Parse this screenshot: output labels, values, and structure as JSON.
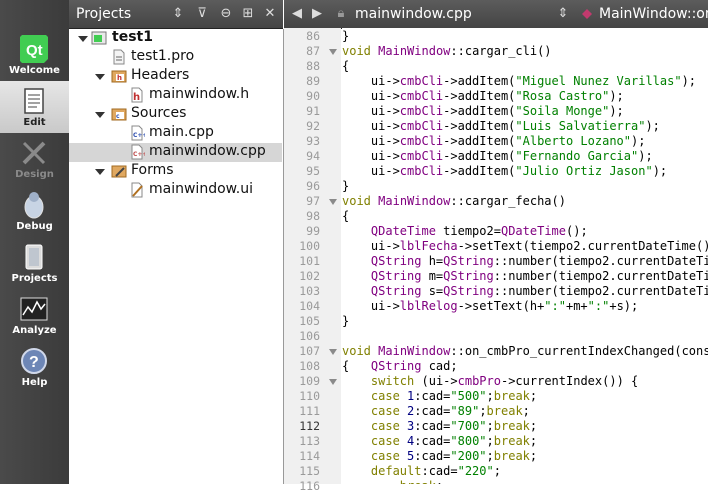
{
  "modes": [
    {
      "label": "Welcome",
      "icon": "qt-logo-icon",
      "state": "normal"
    },
    {
      "label": "Edit",
      "icon": "edit-document-icon",
      "state": "active"
    },
    {
      "label": "Design",
      "icon": "design-icon",
      "state": "disabled"
    },
    {
      "label": "Debug",
      "icon": "debug-bug-icon",
      "state": "normal"
    },
    {
      "label": "Projects",
      "icon": "projects-icon",
      "state": "normal"
    },
    {
      "label": "Analyze",
      "icon": "analyze-icon",
      "state": "normal"
    },
    {
      "label": "Help",
      "icon": "help-icon",
      "state": "normal"
    }
  ],
  "qt_logo_text": "Qt",
  "sidebar": {
    "title": "Projects",
    "tree": [
      {
        "label": "test1",
        "bold": true,
        "icon": "project-icon"
      },
      {
        "label": "test1.pro",
        "icon": "pro-file-icon"
      },
      {
        "label": "Headers",
        "icon": "folder-headers-icon"
      },
      {
        "label": "mainwindow.h",
        "icon": "header-file-icon"
      },
      {
        "label": "Sources",
        "icon": "folder-sources-icon"
      },
      {
        "label": "main.cpp",
        "icon": "cpp-file-icon"
      },
      {
        "label": "mainwindow.cpp",
        "icon": "cpp-file-icon",
        "selected": true
      },
      {
        "label": "Forms",
        "icon": "folder-forms-icon"
      },
      {
        "label": "mainwindow.ui",
        "icon": "ui-file-icon"
      }
    ]
  },
  "editor": {
    "file": "mainwindow.cpp",
    "function": "MainWindow::on",
    "current_line": "112",
    "lines": [
      {
        "n": "86",
        "t": "}"
      },
      {
        "n": "87",
        "t": "void MainWindow::cargar_cli()",
        "fold": true
      },
      {
        "n": "88",
        "t": "{"
      },
      {
        "n": "89",
        "t": "    ui->cmbCli->addItem(\"Miguel Nunez Varillas\");"
      },
      {
        "n": "90",
        "t": "    ui->cmbCli->addItem(\"Rosa Castro\");"
      },
      {
        "n": "91",
        "t": "    ui->cmbCli->addItem(\"Soila Monge\");"
      },
      {
        "n": "92",
        "t": "    ui->cmbCli->addItem(\"Luis Salvatierra\");"
      },
      {
        "n": "93",
        "t": "    ui->cmbCli->addItem(\"Alberto Lozano\");"
      },
      {
        "n": "94",
        "t": "    ui->cmbCli->addItem(\"Fernando Garcia\");"
      },
      {
        "n": "95",
        "t": "    ui->cmbCli->addItem(\"Julio Ortiz Jason\");"
      },
      {
        "n": "96",
        "t": "}"
      },
      {
        "n": "97",
        "t": "void MainWindow::cargar_fecha()",
        "fold": true
      },
      {
        "n": "98",
        "t": "{"
      },
      {
        "n": "99",
        "t": "    QDateTime tiempo2=QDateTime();"
      },
      {
        "n": "100",
        "t": "    ui->lblFecha->setText(tiempo2.currentDateTime()"
      },
      {
        "n": "101",
        "t": "    QString h=QString::number(tiempo2.currentDateTi"
      },
      {
        "n": "102",
        "t": "    QString m=QString::number(tiempo2.currentDateTi"
      },
      {
        "n": "103",
        "t": "    QString s=QString::number(tiempo2.currentDateTi"
      },
      {
        "n": "104",
        "t": "    ui->lblRelog->setText(h+\":\"+m+\":\"+s);"
      },
      {
        "n": "105",
        "t": "}"
      },
      {
        "n": "106",
        "t": ""
      },
      {
        "n": "107",
        "t": "void MainWindow::on_cmbPro_currentIndexChanged(cons",
        "fold": true
      },
      {
        "n": "108",
        "t": "{   QString cad;"
      },
      {
        "n": "109",
        "t": "    switch (ui->cmbPro->currentIndex()) {",
        "fold": true
      },
      {
        "n": "110",
        "t": "    case 1:cad=\"500\";break;"
      },
      {
        "n": "111",
        "t": "    case 2:cad=\"89\";break;"
      },
      {
        "n": "112",
        "t": "    case 3:cad=\"700\";break;"
      },
      {
        "n": "113",
        "t": "    case 4:cad=\"800\";break;"
      },
      {
        "n": "114",
        "t": "    case 5:cad=\"200\";break;"
      },
      {
        "n": "115",
        "t": "    default:cad=\"220\";"
      },
      {
        "n": "116",
        "t": "        break;"
      }
    ]
  }
}
